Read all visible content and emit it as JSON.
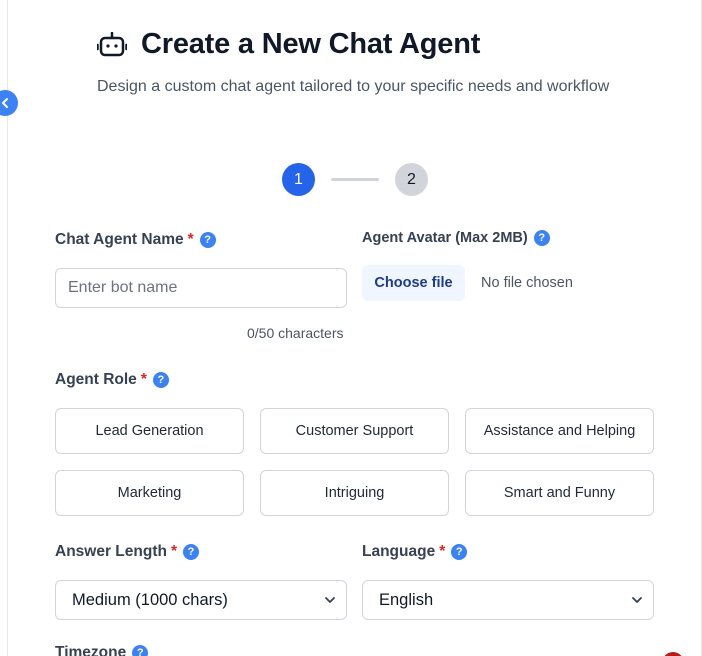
{
  "header": {
    "title": "Create a New Chat Agent",
    "subtitle": "Design a custom chat agent tailored to your specific needs and workflow"
  },
  "stepper": {
    "steps": [
      {
        "label": "1",
        "active": true
      },
      {
        "label": "2",
        "active": false
      }
    ]
  },
  "form": {
    "agent_name": {
      "label": "Chat Agent Name",
      "required": "*",
      "placeholder": "Enter bot name",
      "value": "",
      "char_count": "0/50 characters"
    },
    "avatar": {
      "label": "Agent Avatar (Max 2MB)",
      "button": "Choose file",
      "status": "No file chosen"
    },
    "agent_role": {
      "label": "Agent Role",
      "required": "*",
      "options": [
        "Lead Generation",
        "Customer Support",
        "Assistance and Helping",
        "Marketing",
        "Intriguing",
        "Smart and Funny"
      ]
    },
    "answer_length": {
      "label": "Answer Length",
      "required": "*",
      "value": "Medium (1000 chars)"
    },
    "language": {
      "label": "Language",
      "required": "*",
      "value": "English"
    },
    "timezone": {
      "label": "Timezone"
    }
  },
  "help_glyph": "?",
  "colors": {
    "primary": "#2563eb",
    "required": "#dc2626",
    "help": "#3b82f6",
    "file_button_bg": "#eff6ff"
  },
  "icons": {
    "header": "robot-icon",
    "collapse": "chevron-left-icon",
    "help": "question-circle-icon",
    "select": "chevron-down-icon"
  }
}
